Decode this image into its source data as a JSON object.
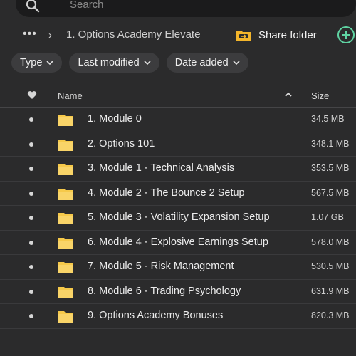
{
  "search": {
    "placeholder": "Search"
  },
  "breadcrumb": {
    "more": "•••",
    "separator": "›",
    "current": "1. Options Academy Elevate"
  },
  "toolbar": {
    "share_label": "Share folder",
    "add_icon": "plus-circle-icon"
  },
  "filters": [
    {
      "label": "Type"
    },
    {
      "label": "Last modified"
    },
    {
      "label": "Date added"
    }
  ],
  "table": {
    "columns": {
      "name": "Name",
      "size": "Size"
    },
    "rows": [
      {
        "name": "1. Module 0",
        "size": "34.5 MB"
      },
      {
        "name": "2. Options 101",
        "size": "348.1 MB"
      },
      {
        "name": "3. Module 1 - Technical Analysis",
        "size": "353.5 MB"
      },
      {
        "name": "4. Module 2 - The Bounce 2 Setup",
        "size": "567.5 MB"
      },
      {
        "name": "5. Module 3 - Volatility Expansion Setup",
        "size": "1.07 GB"
      },
      {
        "name": "6. Module 4 - Explosive Earnings Setup",
        "size": "578.0 MB"
      },
      {
        "name": "7. Module 5 - Risk Management",
        "size": "530.5 MB"
      },
      {
        "name": "8. Module 6 - Trading Psychology",
        "size": "631.9 MB"
      },
      {
        "name": "9. Options Academy Bonuses",
        "size": "820.3 MB"
      }
    ]
  },
  "colors": {
    "accent_green": "#5fd3a2",
    "folder_yellow": "#f6c94a",
    "share_icon": "#f3b52b"
  }
}
